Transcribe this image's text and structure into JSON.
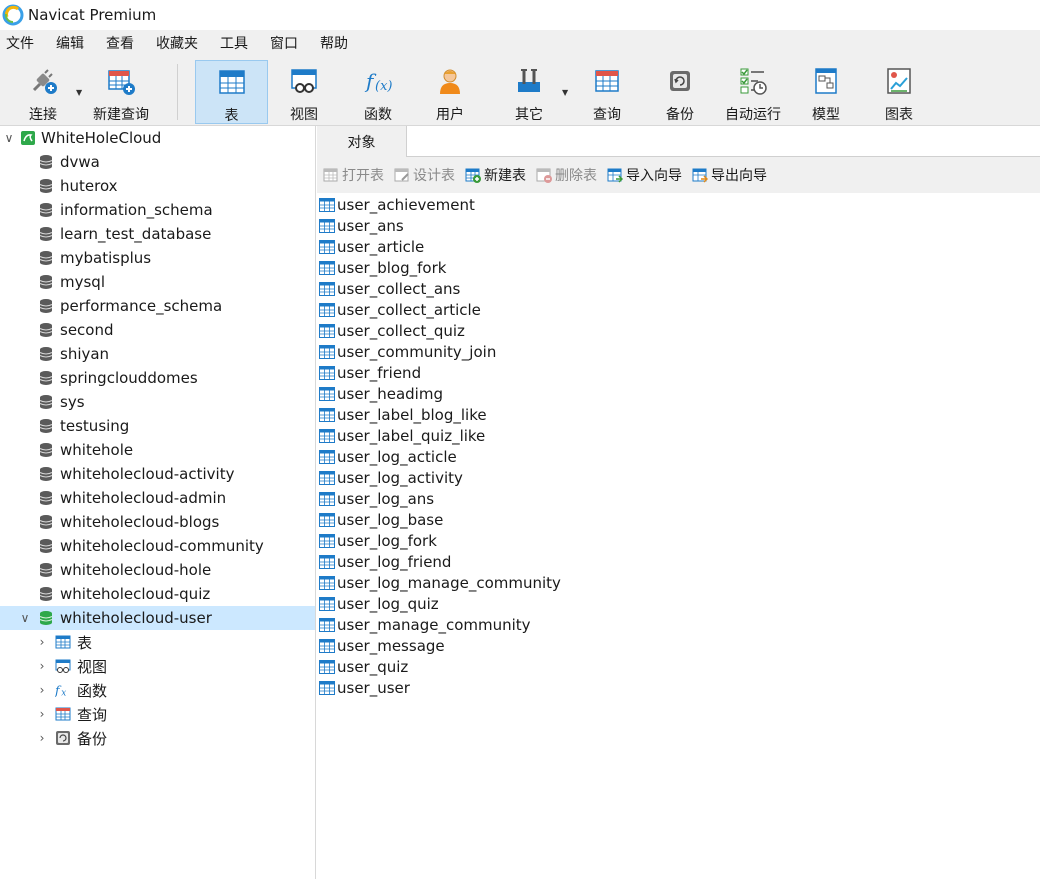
{
  "window": {
    "title": "Navicat Premium"
  },
  "menu": [
    "文件",
    "编辑",
    "查看",
    "收藏夹",
    "工具",
    "窗口",
    "帮助"
  ],
  "toolbar": {
    "connect": "连接",
    "new_query": "新建查询",
    "table": "表",
    "view": "视图",
    "function": "函数",
    "user": "用户",
    "other": "其它",
    "query": "查询",
    "backup": "备份",
    "auto_run": "自动运行",
    "model": "模型",
    "chart": "图表"
  },
  "tree": {
    "connection": "WhiteHoleCloud",
    "databases": [
      "dvwa",
      "huterox",
      "information_schema",
      "learn_test_database",
      "mybatisplus",
      "mysql",
      "performance_schema",
      "second",
      "shiyan",
      "springclouddomes",
      "sys",
      "testusing",
      "whitehole",
      "whiteholecloud-activity",
      "whiteholecloud-admin",
      "whiteholecloud-blogs",
      "whiteholecloud-community",
      "whiteholecloud-hole",
      "whiteholecloud-quiz"
    ],
    "selected_db": "whiteholecloud-user",
    "sub_items": [
      "表",
      "视图",
      "函数",
      "查询",
      "备份"
    ]
  },
  "tabs": {
    "objects": "对象"
  },
  "actions": {
    "open_table": "打开表",
    "design_table": "设计表",
    "new_table": "新建表",
    "delete_table": "删除表",
    "import_wizard": "导入向导",
    "export_wizard": "导出向导"
  },
  "tables": [
    "user_achievement",
    "user_ans",
    "user_article",
    "user_blog_fork",
    "user_collect_ans",
    "user_collect_article",
    "user_collect_quiz",
    "user_community_join",
    "user_friend",
    "user_headimg",
    "user_label_blog_like",
    "user_label_quiz_like",
    "user_log_acticle",
    "user_log_activity",
    "user_log_ans",
    "user_log_base",
    "user_log_fork",
    "user_log_friend",
    "user_log_manage_community",
    "user_log_quiz",
    "user_manage_community",
    "user_message",
    "user_quiz",
    "user_user"
  ],
  "colors": {
    "selection": "#cce8ff",
    "toolbar_active": "#cce4f7",
    "accent_blue": "#1e7bc8"
  }
}
